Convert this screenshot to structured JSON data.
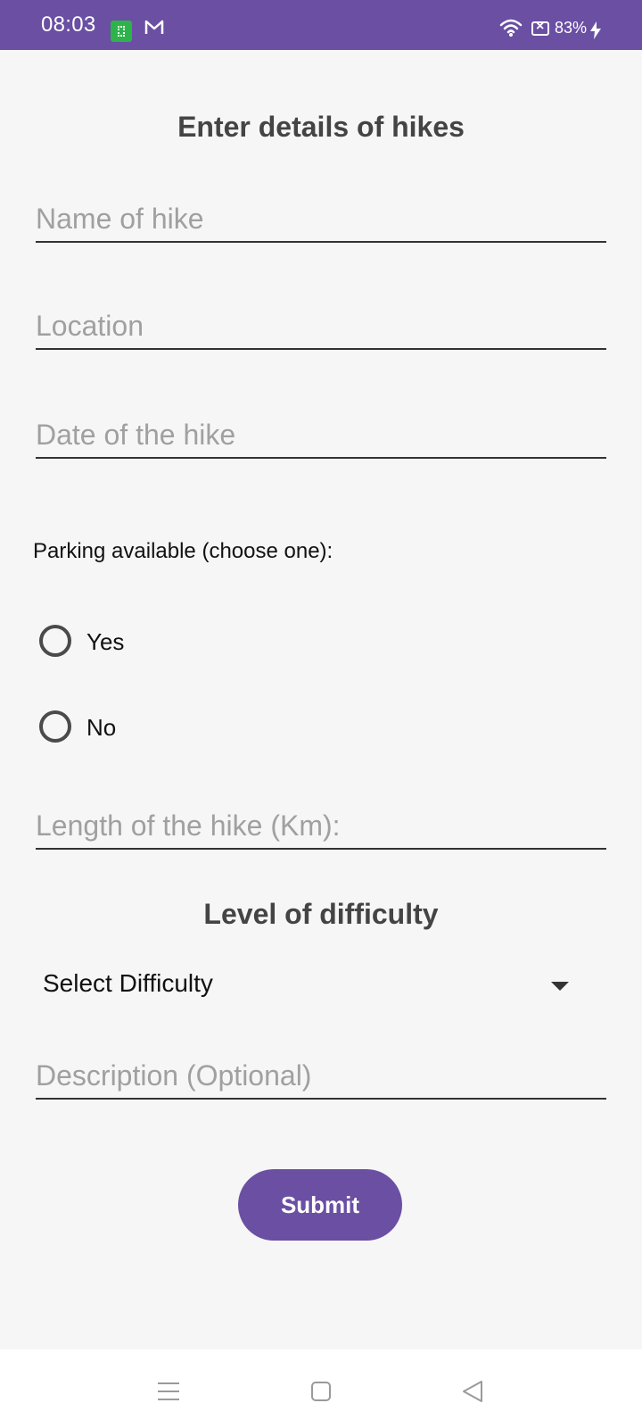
{
  "status_bar": {
    "time": "08:03",
    "battery": "83%",
    "icons": [
      "app-notification-icon",
      "mail-icon",
      "wifi-icon",
      "battery-saver-icon",
      "charging-icon"
    ],
    "color": "#6a4fa3"
  },
  "form": {
    "title": "Enter details of hikes",
    "name_placeholder": "Name of hike",
    "location_placeholder": "Location",
    "date_placeholder": "Date of the hike",
    "parking_label": "Parking available (choose one):",
    "parking_options": [
      {
        "label": "Yes",
        "selected": false
      },
      {
        "label": "No",
        "selected": false
      }
    ],
    "length_placeholder": "Length of the hike (Km):",
    "difficulty_heading": "Level of difficulty",
    "difficulty_value": "Select Difficulty",
    "description_placeholder": "Description (Optional)",
    "submit_label": "Submit"
  },
  "nav_bar": {
    "icons": [
      "menu-icon",
      "home-icon",
      "back-icon"
    ]
  },
  "colors": {
    "accent": "#6a4fa3",
    "background": "#f6f6f6",
    "placeholder": "#a0a0a0"
  }
}
